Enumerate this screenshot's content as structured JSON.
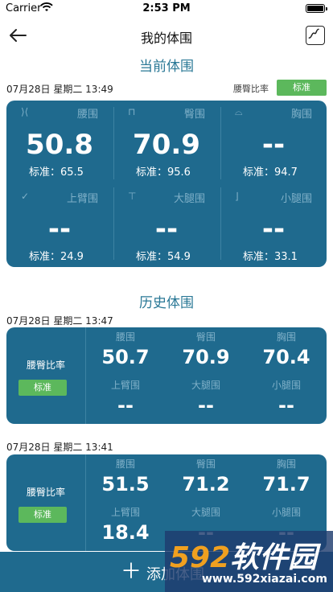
{
  "status_bar": {
    "carrier": "Carrier",
    "time": "2:53 PM"
  },
  "nav": {
    "title": "我的体围"
  },
  "current": {
    "section_title": "当前体围",
    "date": "07月28日 星期二 13:49",
    "ratio_label": "腰臀比率",
    "ratio_badge": "标准",
    "cells": [
      {
        "label": "腰围",
        "value": "50.8",
        "std": "标准：65.5",
        "icon": "waist-icon"
      },
      {
        "label": "臀围",
        "value": "70.9",
        "std": "标准：95.6",
        "icon": "hip-icon"
      },
      {
        "label": "胸围",
        "value": "--",
        "std": "标准：94.7",
        "icon": "chest-icon"
      },
      {
        "label": "上臂围",
        "value": "--",
        "std": "标准：24.9",
        "icon": "arm-icon"
      },
      {
        "label": "大腿围",
        "value": "--",
        "std": "标准：54.9",
        "icon": "thigh-icon"
      },
      {
        "label": "小腿围",
        "value": "--",
        "std": "标准：33.1",
        "icon": "calf-icon"
      }
    ]
  },
  "history": {
    "section_title": "历史体围",
    "records": [
      {
        "date": "07月28日 星期二 13:47",
        "ratio_label": "腰臀比率",
        "ratio_badge": "标准",
        "cells": [
          {
            "label": "腰围",
            "value": "50.7"
          },
          {
            "label": "臀围",
            "value": "70.9"
          },
          {
            "label": "胸围",
            "value": "70.4"
          },
          {
            "label": "上臂围",
            "value": "--"
          },
          {
            "label": "大腿围",
            "value": "--"
          },
          {
            "label": "小腿围",
            "value": "--"
          }
        ]
      },
      {
        "date": "07月28日 星期二 13:41",
        "ratio_label": "腰臀比率",
        "ratio_badge": "标准",
        "cells": [
          {
            "label": "腰围",
            "value": "51.5"
          },
          {
            "label": "臀围",
            "value": "71.2"
          },
          {
            "label": "胸围",
            "value": "71.7"
          },
          {
            "label": "上臂围",
            "value": "18.4"
          },
          {
            "label": "大腿围",
            "value": "--"
          },
          {
            "label": "小腿围",
            "value": "--"
          }
        ]
      }
    ]
  },
  "add_button": {
    "label": "添加体围"
  },
  "watermark": {
    "brand_num": "592",
    "brand_text": "软件园",
    "url": "www.592xiazai.com"
  },
  "colors": {
    "card": "#1f6a8e",
    "accent": "#2a7896",
    "badge": "#5cb85c"
  }
}
